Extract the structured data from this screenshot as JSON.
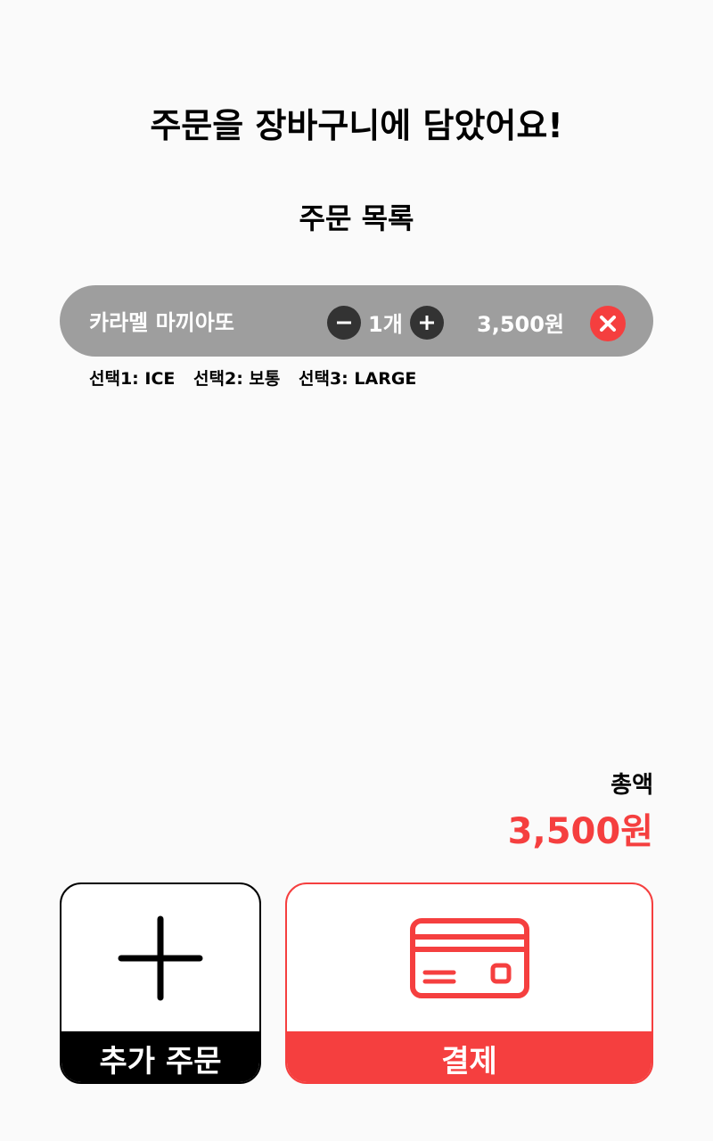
{
  "header": {
    "title": "주문을 장바구니에 담았어요!",
    "section_title": "주문 목록"
  },
  "order_items": [
    {
      "name": "카라멜 마끼아또",
      "quantity": "1개",
      "price": "3,500원",
      "options": [
        "선택1: ICE",
        "선택2: 보통",
        "선택3: LARGE"
      ]
    }
  ],
  "icons": {
    "decrease": "minus-circle-icon",
    "increase": "plus-circle-icon",
    "remove": "close-circle-icon",
    "add_order": "plus-icon",
    "payment": "credit-card-icon"
  },
  "summary": {
    "total_label": "총액",
    "total_value": "3,500원"
  },
  "actions": {
    "add_order_label": "추가 주문",
    "pay_label": "결제"
  },
  "colors": {
    "accent": "#f53f3f",
    "item_background": "#9e9e9e",
    "qty_button": "#333333",
    "background": "#fafafa"
  }
}
